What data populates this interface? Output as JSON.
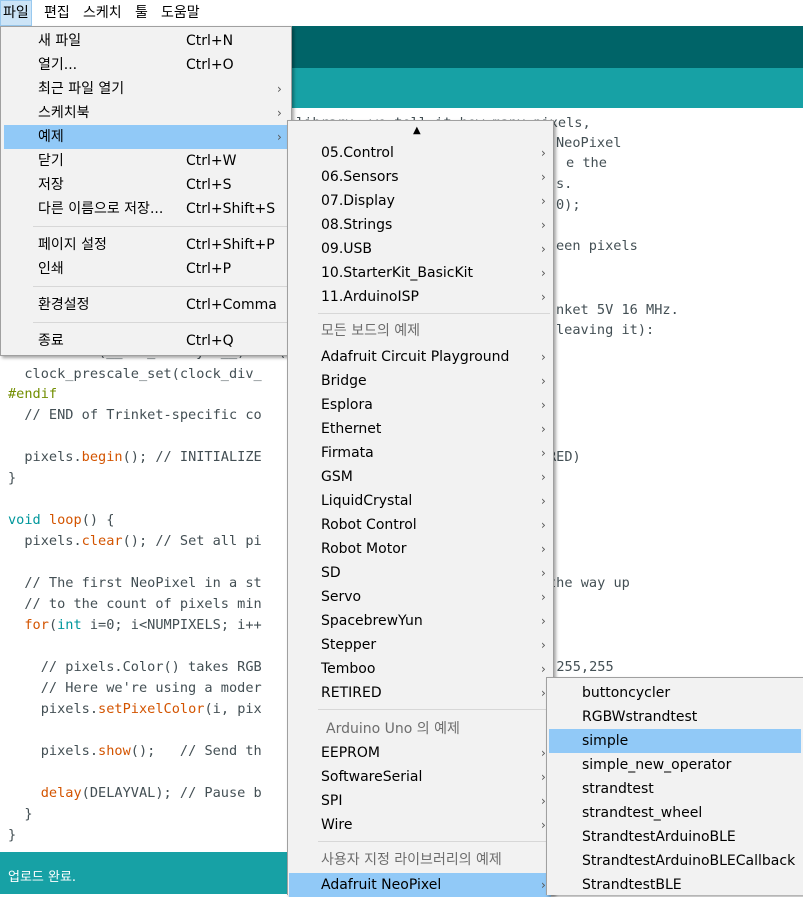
{
  "menubar": [
    "파일",
    "편집",
    "스케치",
    "툴",
    "도움말"
  ],
  "file_menu": {
    "items": [
      {
        "label": "새 파일",
        "shortcut": "Ctrl+N"
      },
      {
        "label": "열기...",
        "shortcut": "Ctrl+O"
      },
      {
        "label": "최근 파일 열기",
        "shortcut": ""
      },
      {
        "label": "스케치북",
        "shortcut": ""
      },
      {
        "label": "예제",
        "shortcut": ""
      },
      {
        "label": "닫기",
        "shortcut": "Ctrl+W"
      },
      {
        "label": "저장",
        "shortcut": "Ctrl+S"
      },
      {
        "label": "다른 이름으로 저장...",
        "shortcut": "Ctrl+Shift+S"
      },
      {
        "label": "페이지 설정",
        "shortcut": "Ctrl+Shift+P"
      },
      {
        "label": "인쇄",
        "shortcut": "Ctrl+P"
      },
      {
        "label": "환경설정",
        "shortcut": "Ctrl+Comma"
      },
      {
        "label": "종료",
        "shortcut": "Ctrl+Q"
      }
    ]
  },
  "examples_menu": {
    "scroll_up": "▲",
    "builtin": [
      "05.Control",
      "06.Sensors",
      "07.Display",
      "08.Strings",
      "09.USB",
      "10.StarterKit_BasicKit",
      "11.ArduinoISP"
    ],
    "all_boards_header": "모든 보드의 예제",
    "all_boards": [
      "Adafruit Circuit Playground",
      "Bridge",
      "Esplora",
      "Ethernet",
      "Firmata",
      "GSM",
      "LiquidCrystal",
      "Robot Control",
      "Robot Motor",
      "SD",
      "Servo",
      "SpacebrewYun",
      "Stepper",
      "Temboo",
      "RETIRED"
    ],
    "uno_header": "Arduino Uno 의 예제",
    "uno": [
      "EEPROM",
      "SoftwareSerial",
      "SPI",
      "Wire"
    ],
    "custom_header": "사용자 지정 라이브러리의 예제",
    "custom": [
      "Adafruit NeoPixel"
    ]
  },
  "neopixel_menu": [
    "buttoncycler",
    "RGBWstrandtest",
    "simple",
    "simple_new_operator",
    "strandtest",
    "strandtest_wheel",
    "StrandtestArduinoBLE",
    "StrandtestArduinoBLECallback",
    "StrandtestBLE"
  ],
  "code_right": [
    "library, we tell it how many pixels,",
    "NeoPixel",
    "e the",
    "s.",
    "0);",
    "een pixels",
    "nket 5V 16 MHz.",
    "leaving it):"
  ],
  "code_left": {
    "l_define": "#if defined(__AVR_ATtiny85__) && (F_CPU == 16000000)",
    "l_prescale": "  clock_prescale_set(clock_div_",
    "l_endif": "#endif",
    "l_endtrinket": "  // END of Trinket-specific co",
    "l_begin_obj": "pixels",
    "l_begin_fn": "begin",
    "l_begin_rest": "(); // INITIALIZE",
    "l_red": "RED)",
    "l_close1": "}",
    "l_void": "void",
    "l_loop": "loop",
    "l_loop_rest": "() {",
    "l_clear_obj": "pixels",
    "l_clear_fn": "clear",
    "l_clear_rest": "(); // Set all pi",
    "l_first": "  // The first NeoPixel in a st",
    "l_first_r": "the way up",
    "l_count": "  // to the count of pixels min",
    "l_for": "for",
    "l_int": "int",
    "l_for_rest": " i=0; i<NUMPIXELS; i++",
    "l_color": "    // pixels.Color() takes RGB",
    "l_color_r": ", 255,255",
    "l_here": "    // Here we're using a moder",
    "l_set_obj": "pixels",
    "l_set_fn": "setPixelColor",
    "l_set_rest": "(i, pix",
    "l_show_obj": "pixels",
    "l_show_fn": "show",
    "l_show_rest": "();   // Send th",
    "l_delay_fn": "delay",
    "l_delay_rest": "(DELAYVAL); // Pause b",
    "l_close2": "  }",
    "l_close3": "}"
  },
  "status_text": "업로드 완료."
}
